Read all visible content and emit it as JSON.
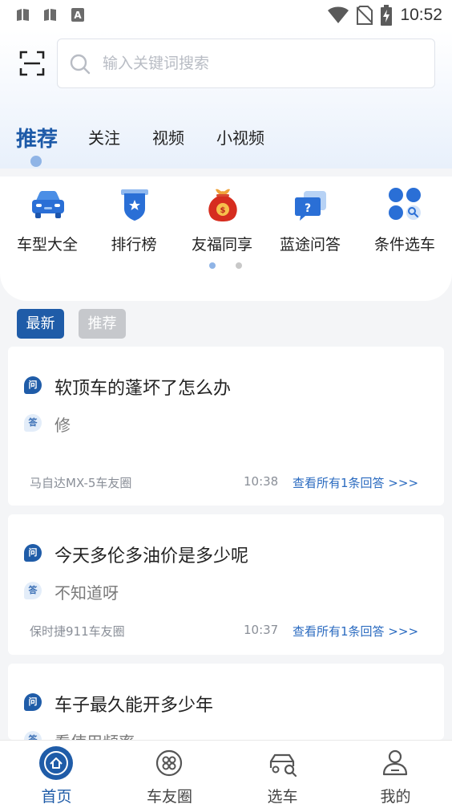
{
  "status_bar": {
    "time": "10:52",
    "icons": [
      "sim-card-icon",
      "sim-card-icon",
      "app-notification-icon",
      "wifi-icon",
      "no-sim-icon",
      "battery-charging-icon"
    ]
  },
  "search": {
    "placeholder": "输入关键词搜索",
    "value": "",
    "scan_icon": "scan-icon",
    "search_icon": "search-icon"
  },
  "tabs": [
    {
      "label": "推荐",
      "active": true
    },
    {
      "label": "关注",
      "active": false
    },
    {
      "label": "视频",
      "active": false
    },
    {
      "label": "小视频",
      "active": false
    }
  ],
  "quick_nav": {
    "items": [
      {
        "label": "车型大全",
        "icon": "car-icon"
      },
      {
        "label": "排行榜",
        "icon": "ranking-badge-icon"
      },
      {
        "label": "友福同享",
        "icon": "lucky-bag-icon"
      },
      {
        "label": "蓝途问答",
        "icon": "question-chat-icon"
      },
      {
        "label": "条件选车",
        "icon": "filter-dots-icon"
      }
    ],
    "pages": 2,
    "current_page": 1
  },
  "filters": [
    {
      "label": "最新",
      "active": true
    },
    {
      "label": "推荐",
      "active": false
    }
  ],
  "badges": {
    "question": "问",
    "answer": "答"
  },
  "questions": [
    {
      "question": "软顶车的蓬坏了怎么办",
      "answer": "修",
      "circle": "马自达MX-5车友圈",
      "time": "10:38",
      "link": "查看所有1条回答 >>>"
    },
    {
      "question": "今天多伦多油价是多少呢",
      "answer": "不知道呀",
      "circle": "保时捷911车友圈",
      "time": "10:37",
      "link": "查看所有1条回答 >>>"
    },
    {
      "question": "车子最久能开多少年",
      "answer": "看使用频率"
    }
  ],
  "bottom_nav": [
    {
      "label": "首页",
      "icon": "home-icon",
      "active": true
    },
    {
      "label": "车友圈",
      "icon": "circle-community-icon",
      "active": false
    },
    {
      "label": "选车",
      "icon": "car-search-icon",
      "active": false
    },
    {
      "label": "我的",
      "icon": "user-icon",
      "active": false
    }
  ],
  "colors": {
    "accent": "#1f5ca8",
    "tab_active": "#1d5aa8",
    "link": "#2b6bc0",
    "chip_inactive": "#c6c8cc"
  }
}
